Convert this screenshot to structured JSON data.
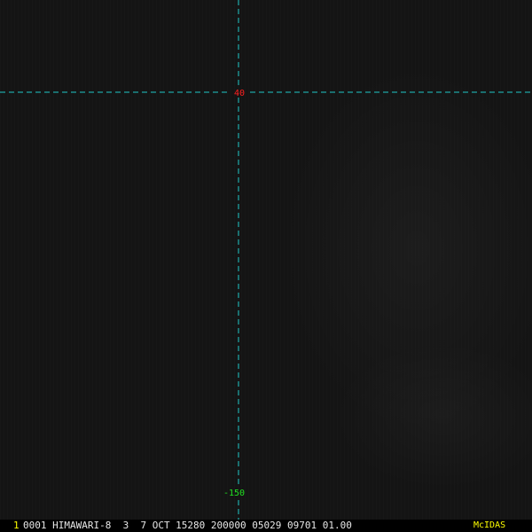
{
  "viewer": {
    "frame_number": "1",
    "frame_info": "0001 HIMAWARI-8  3  7 OCT 15280 200000 05029 09701 01.00",
    "brand": "McIDAS"
  },
  "grid": {
    "latitude_label": "40",
    "longitude_label": "-150",
    "line_color": "#1fc9c9",
    "latitude_label_color": "#ff2020",
    "longitude_label_color": "#20e020"
  }
}
